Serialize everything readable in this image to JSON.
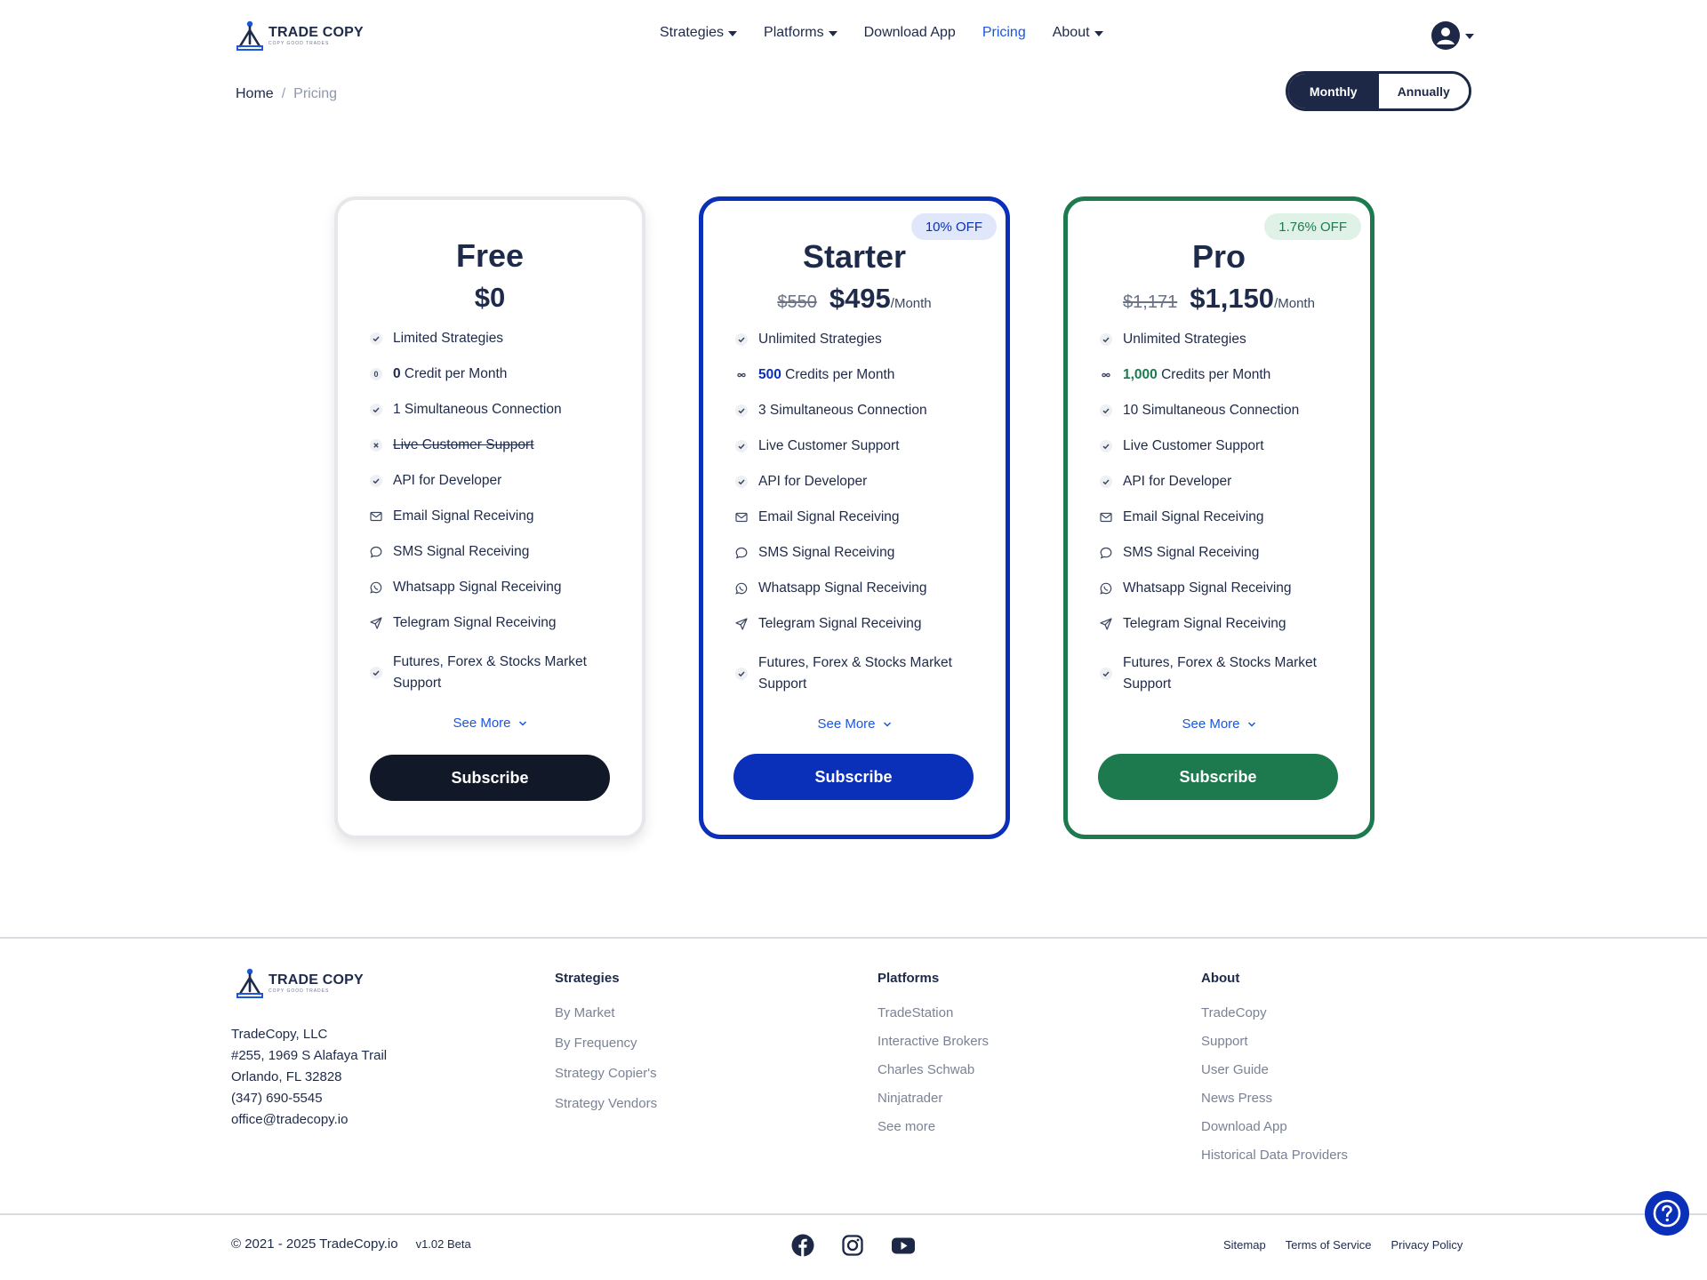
{
  "brand": {
    "name": "TRADE COPY",
    "tagline": "COPY GOOD TRADES"
  },
  "nav": {
    "items": [
      {
        "label": "Strategies",
        "has_caret": true
      },
      {
        "label": "Platforms",
        "has_caret": true
      },
      {
        "label": "Download App",
        "has_caret": false
      },
      {
        "label": "Pricing",
        "has_caret": false,
        "active": true
      },
      {
        "label": "About",
        "has_caret": true
      }
    ],
    "user_icon": "user-circle-icon"
  },
  "breadcrumb": {
    "home": "Home",
    "separator": "/",
    "current": "Pricing"
  },
  "billing_toggle": {
    "monthly": "Monthly",
    "annually": "Annually",
    "selected": "Monthly"
  },
  "plans": [
    {
      "name": "Free",
      "price": "$0",
      "features": [
        {
          "icon": "check-icon",
          "text": "Limited Strategies"
        },
        {
          "icon": "zero-icon",
          "num": "0",
          "text": " Credit per Month"
        },
        {
          "icon": "check-icon",
          "text": "1 Simultaneous Connection"
        },
        {
          "icon": "x-icon",
          "text": "Live Customer Support",
          "strike": true
        },
        {
          "icon": "check-icon",
          "text": "API for Developer"
        },
        {
          "icon": "mail-icon",
          "text": "Email Signal Receiving"
        },
        {
          "icon": "chat-icon",
          "text": "SMS Signal Receiving"
        },
        {
          "icon": "whatsapp-icon",
          "text": "Whatsapp Signal Receiving"
        },
        {
          "icon": "send-icon",
          "text": "Telegram Signal Receiving"
        },
        {
          "icon": "check-icon",
          "text": "Futures, Forex & Stocks Market Support"
        }
      ],
      "see_more": "See More",
      "cta": "Subscribe"
    },
    {
      "name": "Starter",
      "badge": "10% OFF",
      "old_price": "$550",
      "price": "$495",
      "period": "/Month",
      "features": [
        {
          "icon": "check-icon",
          "text": "Unlimited Strategies"
        },
        {
          "icon": "infinity-icon",
          "num": "500",
          "text": " Credits per Month"
        },
        {
          "icon": "check-icon",
          "text": "3 Simultaneous Connection"
        },
        {
          "icon": "check-icon",
          "text": "Live Customer Support"
        },
        {
          "icon": "check-icon",
          "text": "API for Developer"
        },
        {
          "icon": "mail-icon",
          "text": "Email Signal Receiving"
        },
        {
          "icon": "chat-icon",
          "text": "SMS Signal Receiving"
        },
        {
          "icon": "whatsapp-icon",
          "text": "Whatsapp Signal Receiving"
        },
        {
          "icon": "send-icon",
          "text": "Telegram Signal Receiving"
        },
        {
          "icon": "check-icon",
          "text": "Futures, Forex & Stocks Market Support"
        }
      ],
      "see_more": "See More",
      "cta": "Subscribe"
    },
    {
      "name": "Pro",
      "badge": "1.76% OFF",
      "old_price": "$1,171",
      "price": "$1,150",
      "period": "/Month",
      "features": [
        {
          "icon": "check-icon",
          "text": "Unlimited Strategies"
        },
        {
          "icon": "infinity-icon",
          "num": "1,000",
          "text": " Credits per Month"
        },
        {
          "icon": "check-icon",
          "text": "10 Simultaneous Connection"
        },
        {
          "icon": "check-icon",
          "text": "Live Customer Support"
        },
        {
          "icon": "check-icon",
          "text": "API for Developer"
        },
        {
          "icon": "mail-icon",
          "text": "Email Signal Receiving"
        },
        {
          "icon": "chat-icon",
          "text": "SMS Signal Receiving"
        },
        {
          "icon": "whatsapp-icon",
          "text": "Whatsapp Signal Receiving"
        },
        {
          "icon": "send-icon",
          "text": "Telegram Signal Receiving"
        },
        {
          "icon": "check-icon",
          "text": "Futures, Forex & Stocks Market Support"
        }
      ],
      "see_more": "See More",
      "cta": "Subscribe"
    }
  ],
  "footer": {
    "address": [
      "TradeCopy, LLC",
      "#255, 1969 S Alafaya Trail",
      "Orlando, FL 32828",
      "(347) 690-5545",
      "office@tradecopy.io"
    ],
    "columns": [
      {
        "title": "Strategies",
        "links": [
          "By Market",
          "By Frequency",
          "Strategy Copier's",
          "Strategy Vendors"
        ]
      },
      {
        "title": "Platforms",
        "links": [
          "TradeStation",
          "Interactive Brokers",
          "Charles Schwab",
          "Ninjatrader",
          "See more"
        ]
      },
      {
        "title": "About",
        "links": [
          "TradeCopy",
          "Support",
          "User Guide",
          "News Press",
          "Download App",
          "Historical Data Providers"
        ]
      }
    ],
    "copyright": "© 2021 - 2025 TradeCopy.io",
    "version": "v1.02 Beta",
    "social": [
      "facebook-icon",
      "instagram-icon",
      "youtube-icon"
    ],
    "legal": [
      "Sitemap",
      "Terms of Service",
      "Privacy Policy"
    ]
  },
  "colors": {
    "navy": "#1c2845",
    "starter_blue": "#0a2fb8",
    "pro_green": "#1d7a4f",
    "link_blue": "#1a56db"
  }
}
